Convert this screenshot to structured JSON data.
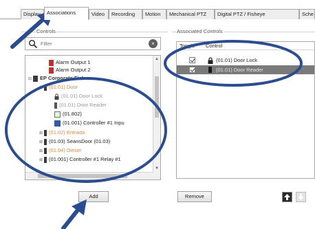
{
  "tabs": [
    {
      "label": "Display",
      "active": false
    },
    {
      "label": "Associations",
      "active": true
    },
    {
      "label": "Video",
      "active": false
    },
    {
      "label": "Recording",
      "active": false
    },
    {
      "label": "Motion",
      "active": false
    },
    {
      "label": "Mechanical PTZ",
      "active": false
    },
    {
      "label": "Digital PTZ / Fisheye",
      "active": false
    },
    {
      "label": "Sche",
      "active": false
    }
  ],
  "available": {
    "group_label": "Controls",
    "filter_placeholder": "Filter",
    "tree": [
      {
        "label": "Alarm Output 1",
        "style": "normal",
        "indent": 2
      },
      {
        "label": "Alarm Output 2",
        "style": "normal",
        "indent": 2
      },
      {
        "label": "EP Corporate Fishers",
        "style": "bold",
        "indent": 0
      },
      {
        "label": "(01.01) Door",
        "style": "orange",
        "indent": 1
      },
      {
        "label": "(01.01) Door Lock",
        "style": "gray",
        "indent": 2
      },
      {
        "label": "(01.01) Door Reader",
        "style": "gray",
        "indent": 2
      },
      {
        "label": "(01.802)",
        "style": "normal",
        "indent": 2
      },
      {
        "label": "(01.001) Controller #1 Inpu",
        "style": "normal",
        "indent": 2
      },
      {
        "label": "(01.02) Entrada",
        "style": "orange",
        "indent": 1
      },
      {
        "label": "(01.03) SeansDoor (01.03)",
        "style": "normal",
        "indent": 1
      },
      {
        "label": "(01.04) Dieser",
        "style": "orange",
        "indent": 1
      },
      {
        "label": "(01.001) Controller #1 Relay #1",
        "style": "normal",
        "indent": 1
      }
    ],
    "add_label": "Add"
  },
  "associated": {
    "group_label": "Associated Controls",
    "col_toggle": "Toggle",
    "col_control": "Control",
    "rows": [
      {
        "label": "(01.01) Door Lock",
        "checked": true,
        "selected": false
      },
      {
        "label": "(01.01) Door Reader",
        "checked": true,
        "selected": true
      }
    ],
    "remove_label": "Remove"
  },
  "colors": {
    "annotation": "#2b4d8f",
    "selection": "#7a7a7a",
    "orange_text": "#d8893a"
  }
}
